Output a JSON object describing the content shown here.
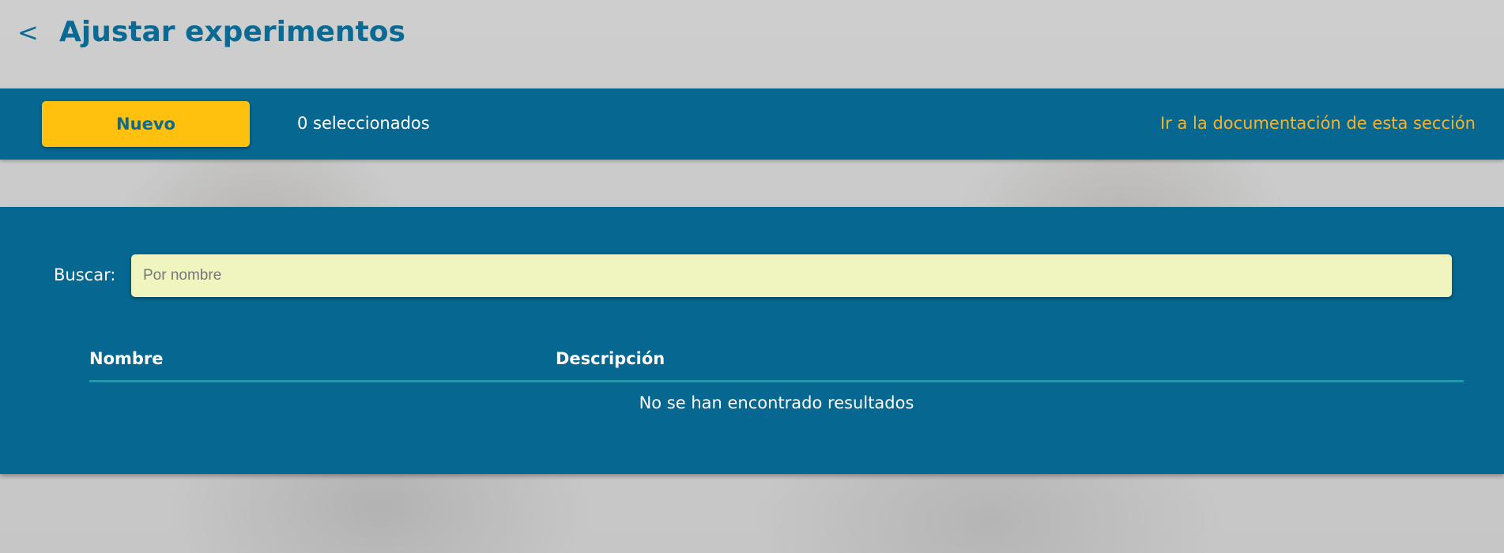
{
  "header": {
    "back_label": "<",
    "title": "Ajustar experimentos"
  },
  "toolbar": {
    "new_label": "Nuevo",
    "selected_count": "0 seleccionados",
    "doc_link": "Ir a la documentación de esta sección"
  },
  "search": {
    "label": "Buscar:",
    "value": "",
    "placeholder": "Por nombre"
  },
  "table": {
    "columns": [
      "Nombre",
      "Descripción"
    ],
    "rows": [],
    "empty_message": "No se han encontrado resultados"
  },
  "colors": {
    "primary": "#066790",
    "accent": "#ffc10e",
    "link": "#f2b431",
    "search_bg": "#f0f4bf",
    "divider": "#17a2a2"
  }
}
